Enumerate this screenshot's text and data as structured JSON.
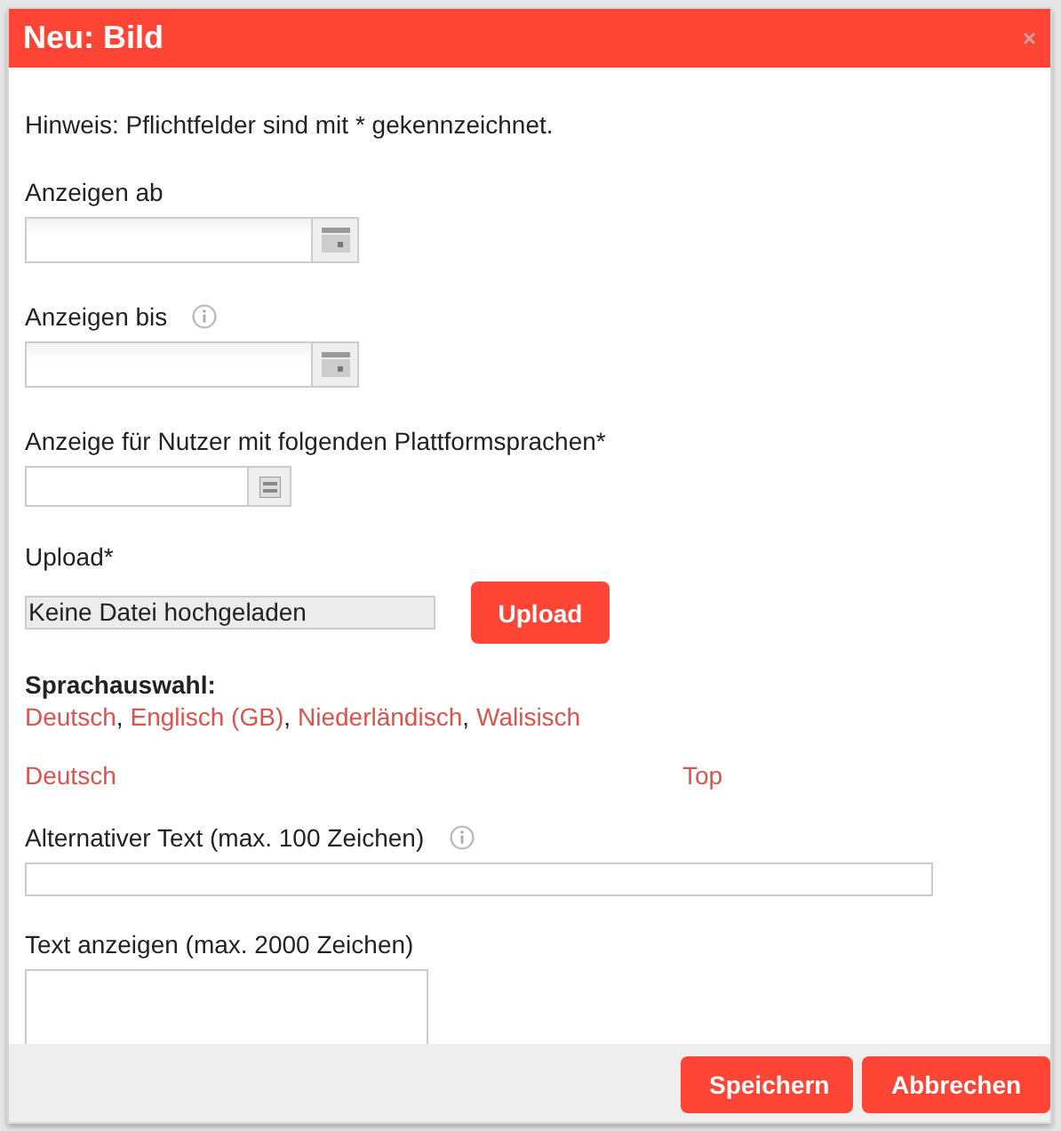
{
  "dialog": {
    "title": "Neu: Bild",
    "close": "×"
  },
  "hint": "Hinweis: Pflichtfelder sind mit * gekennzeichnet.",
  "fields": [
    {
      "kind": "date",
      "label": "Anzeigen ab",
      "info": false
    },
    {
      "kind": "date",
      "label": "Anzeigen bis",
      "info": true
    },
    {
      "kind": "multiselect",
      "label": "Anzeige für Nutzer mit folgenden Plattformsprachen*",
      "info": false
    },
    {
      "kind": "upload",
      "label": "Upload*",
      "info": false,
      "file_status": "Keine Datei hochgeladen",
      "button": "Upload"
    }
  ],
  "language_selection": {
    "label": "Sprachauswahl:",
    "languages": [
      "Deutsch",
      "Englisch (GB)",
      "Niederländisch",
      "Walisisch"
    ],
    "separator": ","
  },
  "section": {
    "language": "Deutsch",
    "top_link": "Top"
  },
  "text_fields": [
    {
      "kind": "line",
      "label": "Alternativer Text (max. 100 Zeichen)",
      "info": true
    },
    {
      "kind": "area",
      "label": "Text anzeigen (max. 2000 Zeichen)",
      "info": false
    }
  ],
  "buttons": [
    "Speichern",
    "Abbrechen"
  ]
}
